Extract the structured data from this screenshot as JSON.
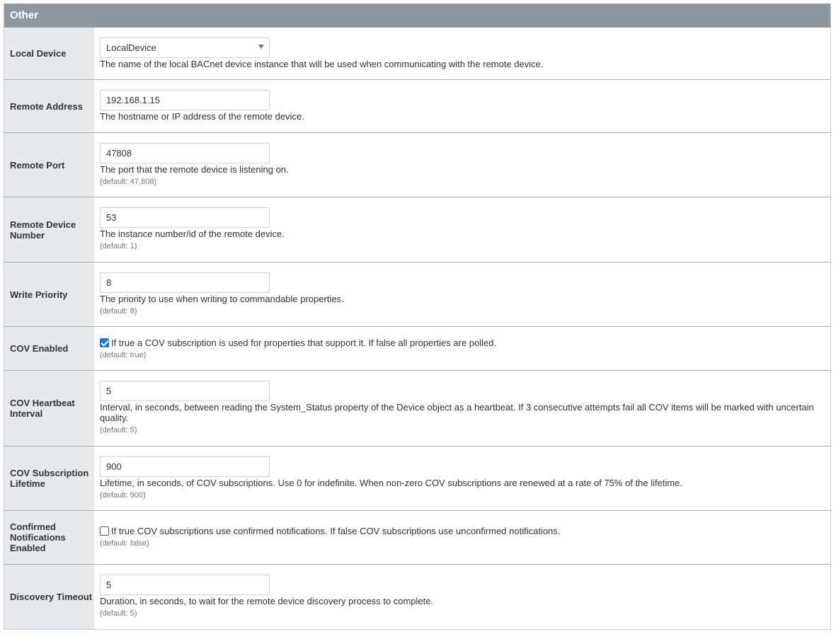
{
  "panel": {
    "title": "Other"
  },
  "fields": {
    "local_device": {
      "label": "Local Device",
      "value": "LocalDevice",
      "desc": "The name of the local BACnet device instance that will be used when communicating with the remote device."
    },
    "remote_address": {
      "label": "Remote Address",
      "value": "192.168.1.15",
      "desc": "The hostname or IP address of the remote device."
    },
    "remote_port": {
      "label": "Remote Port",
      "value": "47808",
      "desc": "The port that the remote device is listening on.",
      "default": "(default: 47,808)"
    },
    "remote_device_number": {
      "label": "Remote Device Number",
      "value": "53",
      "desc": "The instance number/id of the remote device.",
      "default": "(default: 1)"
    },
    "write_priority": {
      "label": "Write Priority",
      "value": "8",
      "desc": "The priority to use when writing to commandable properties.",
      "default": "(default: 8)"
    },
    "cov_enabled": {
      "label": "COV Enabled",
      "checked": true,
      "desc": "If true a COV subscription is used for properties that support it. If false all properties are polled.",
      "default": "(default: true)"
    },
    "cov_heartbeat_interval": {
      "label": "COV Heartbeat Interval",
      "value": "5",
      "desc": "Interval, in seconds, between reading the System_Status property of the Device object as a heartbeat. If 3 consecutive attempts fail all COV items will be marked with uncertain quality.",
      "default": "(default: 5)"
    },
    "cov_subscription_lifetime": {
      "label": "COV Subscription Lifetime",
      "value": "900",
      "desc": "Lifetime, in seconds, of COV subscriptions. Use 0 for indefinite. When non-zero COV subscriptions are renewed at a rate of 75% of the lifetime.",
      "default": "(default: 900)"
    },
    "confirmed_notifications_enabled": {
      "label": "Confirmed Notifications Enabled",
      "checked": false,
      "desc": "If true COV subscriptions use confirmed notifications. If false COV subscriptions use unconfirmed notifications.",
      "default": "(default: false)"
    },
    "discovery_timeout": {
      "label": "Discovery Timeout",
      "value": "5",
      "desc": "Duration, in seconds, to wait for the remote device discovery process to complete.",
      "default": "(default: 5)"
    }
  }
}
